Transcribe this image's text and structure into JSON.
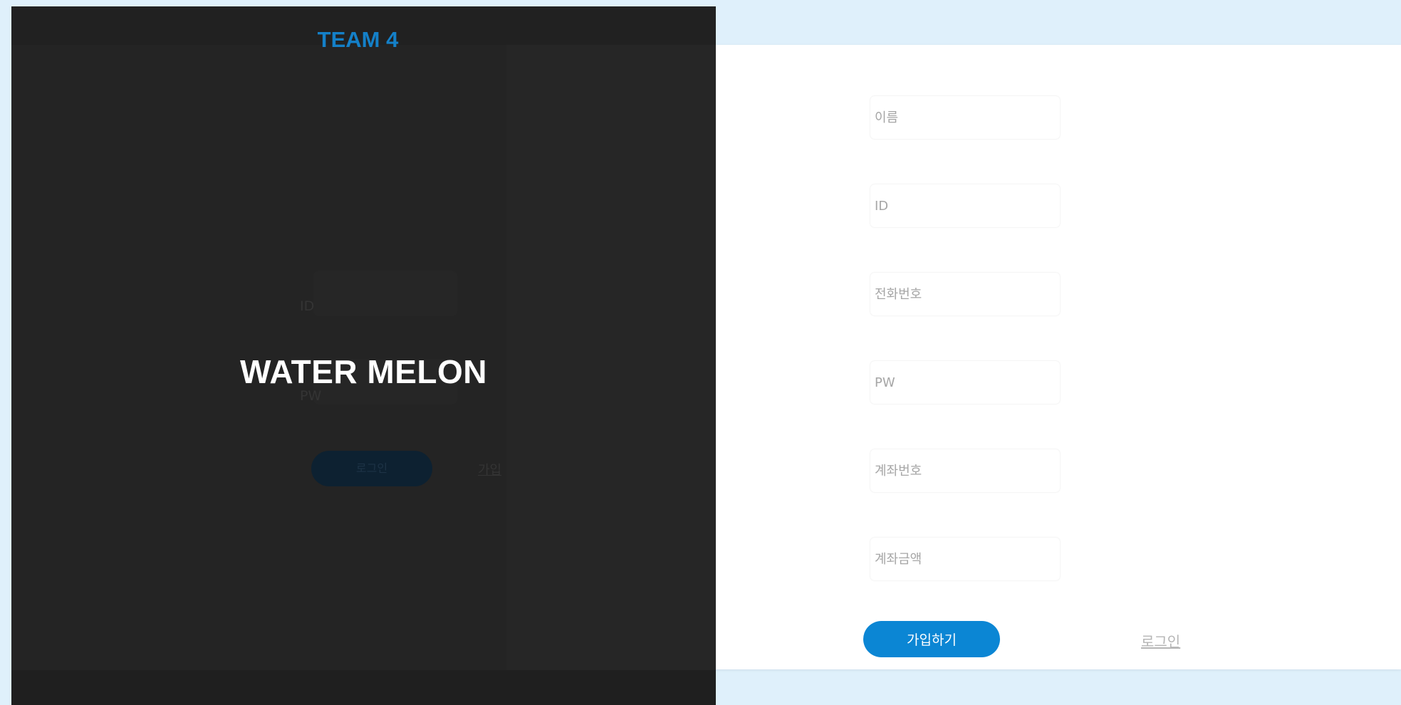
{
  "signup": {
    "fields": [
      {
        "placeholder": "이름"
      },
      {
        "placeholder": "ID"
      },
      {
        "placeholder": "전화번호"
      },
      {
        "placeholder": "PW"
      },
      {
        "placeholder": "계좌번호"
      },
      {
        "placeholder": "계좌금액"
      }
    ],
    "join_button": "가입하기",
    "login_link": "로그인"
  },
  "overlay": {
    "team_title": "TEAM 4",
    "brand_name": "WATER MELON",
    "ghost_login": {
      "id_label": "ID",
      "pw_label": "PW",
      "login_button": "로그인",
      "signup_link": "가입"
    }
  },
  "colors": {
    "page_bg": "#dff0fb",
    "overlay_bg": "#242424",
    "accent": "#0b86d4",
    "team_title": "#1480c8"
  }
}
